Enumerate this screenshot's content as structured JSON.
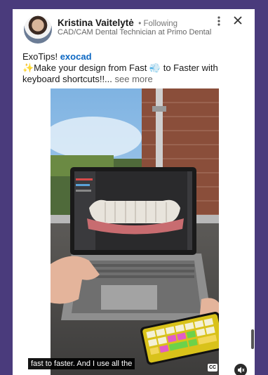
{
  "author": {
    "name": "Kristina Vaitelytė",
    "following": "• Following",
    "headline": "CAD/CAM Dental Technician at Primo Dental"
  },
  "icons": {
    "more": "more-vertical-icon",
    "close": "close-icon",
    "captions": "captions-icon",
    "mute": "mute-icon"
  },
  "post": {
    "line1_prefix": "ExoTips! ",
    "hashtag": "exocad",
    "line2": "✨Make your design from Fast 💨 to Faster with keyboard shortcuts!!...",
    "see_more": " see more"
  },
  "video": {
    "caption": "fast to faster. And I use all the",
    "cc_label": "CC"
  },
  "colors": {
    "background": "#4a3b7c",
    "link": "#0a66c2"
  }
}
